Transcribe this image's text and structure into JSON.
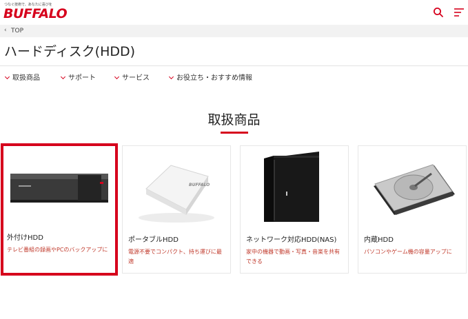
{
  "header": {
    "tagline": "つなぐ技術で、あなたに喜びを",
    "logo": "BUFFALO",
    "search_icon": "search-icon",
    "menu_icon": "hamburger-menu-icon",
    "accent": "#d6001c"
  },
  "breadcrumb": {
    "items": [
      "TOP"
    ]
  },
  "page_title": "ハードディスク(HDD)",
  "subnav": [
    "取扱商品",
    "サポート",
    "サービス",
    "お役立ち・おすすめ情報"
  ],
  "section": {
    "title": "取扱商品"
  },
  "products": [
    {
      "name": "外付けHDD",
      "desc": "テレビ番組の録画やPCのバックアップに",
      "image": "external-hdd-image",
      "selected": true
    },
    {
      "name": "ポータブルHDD",
      "desc": "電源不要でコンパクト、持ち運びに最適",
      "image": "portable-hdd-image",
      "selected": false
    },
    {
      "name": "ネットワーク対応HDD(NAS)",
      "desc": "家中の機器で動画・写真・音楽を共有できる",
      "image": "nas-image",
      "selected": false
    },
    {
      "name": "内蔵HDD",
      "desc": "パソコンやゲーム機の容量アップに",
      "image": "internal-hdd-image",
      "selected": false
    }
  ]
}
